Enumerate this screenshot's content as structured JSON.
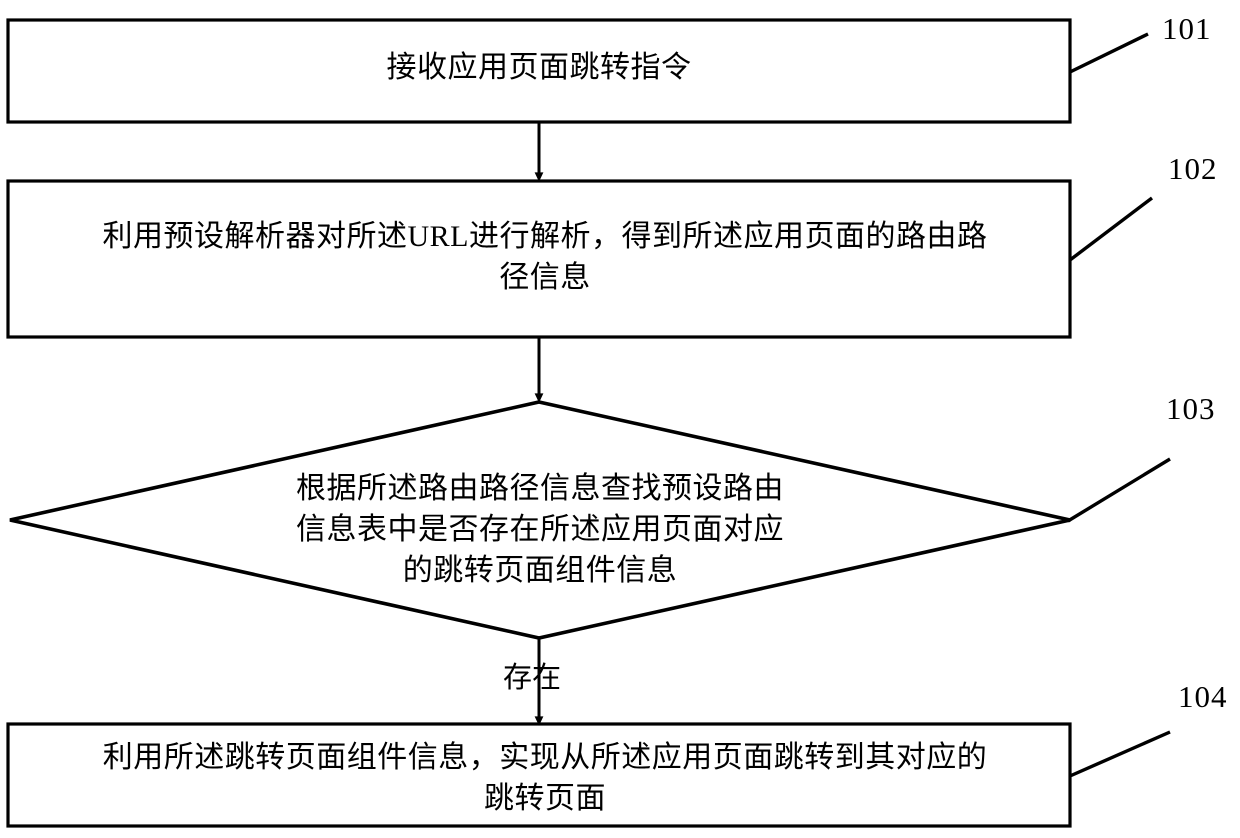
{
  "figure": {
    "type": "flowchart",
    "orientation": "vertical",
    "background_color": "#ffffff",
    "stroke_color": "#000000"
  },
  "nodes": [
    {
      "id": "101",
      "shape": "rectangle",
      "ref": "101",
      "text": "接收应用页面跳转指令",
      "lines": [
        "接收应用页面跳转指令"
      ]
    },
    {
      "id": "102",
      "shape": "rectangle",
      "ref": "102",
      "text": "利用预设解析器对所述URL进行解析，得到所述应用页面的路由路径信息",
      "lines": [
        "利用预设解析器对所述URL进行解析，得到所述应用页面的路由路",
        "径信息"
      ]
    },
    {
      "id": "103",
      "shape": "diamond",
      "ref": "103",
      "text": "根据所述路由路径信息查找预设路由信息表中是否存在所述应用页面对应的跳转页面组件信息",
      "lines": [
        "根据所述路由路径信息查找预设路由",
        "信息表中是否存在所述应用页面对应",
        "的跳转页面组件信息"
      ]
    },
    {
      "id": "104",
      "shape": "rectangle",
      "ref": "104",
      "text": "利用所述跳转页面组件信息，实现从所述应用页面跳转到其对应的跳转页面",
      "lines": [
        "利用所述跳转页面组件信息，实现从所述应用页面跳转到其对应的",
        "跳转页面"
      ]
    }
  ],
  "node_text": {
    "n101": "接收应用页面跳转指令",
    "n102": "利用预设解析器对所述URL进行解析，得到所述应用页面的路由路\n径信息",
    "n103": "根据所述路由路径信息查找预设路由\n信息表中是否存在所述应用页面对应\n的跳转页面组件信息",
    "n104": "利用所述跳转页面组件信息，实现从所述应用页面跳转到其对应的\n跳转页面"
  },
  "reference_labels": {
    "r101": "101",
    "r102": "102",
    "r103": "103",
    "r104": "104"
  },
  "edges": [
    {
      "from": "101",
      "to": "102",
      "label": ""
    },
    {
      "from": "102",
      "to": "103",
      "label": ""
    },
    {
      "from": "103",
      "to": "104",
      "label": "存在"
    }
  ],
  "edge_labels": {
    "exist": "存在"
  }
}
